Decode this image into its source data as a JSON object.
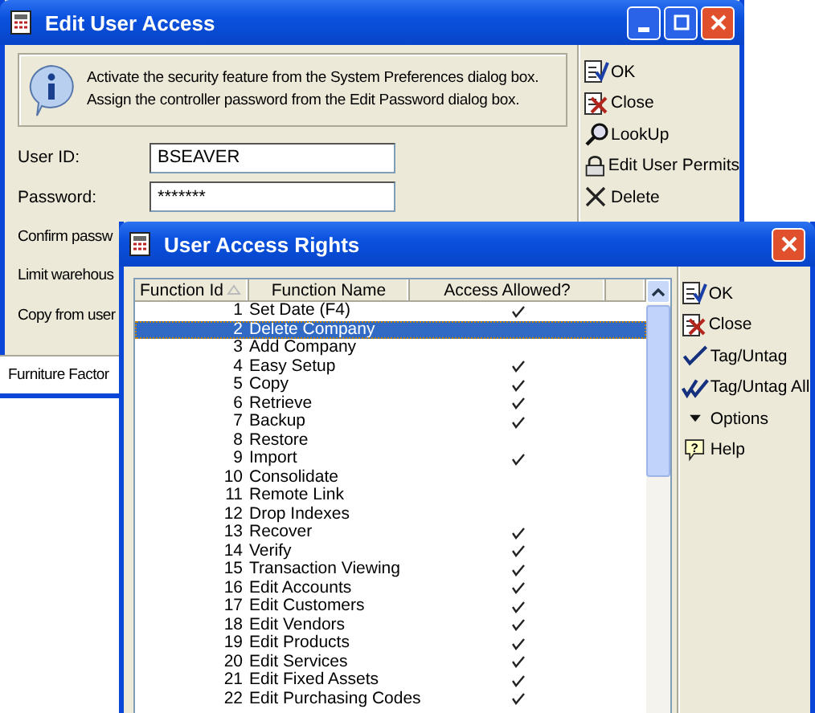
{
  "back_window": {
    "title": "Edit User Access",
    "info": [
      "Activate the security feature from the System Preferences dialog box.",
      "Assign the controller password from the Edit Password dialog box."
    ],
    "fields": [
      {
        "label": "User ID:",
        "value": "BSEAVER",
        "kind": "text"
      },
      {
        "label": "Password:",
        "value": "*******",
        "kind": "text"
      },
      {
        "label": "Confirm passw",
        "kind": "hidden"
      },
      {
        "label": "Limit warehous",
        "kind": "hidden"
      },
      {
        "label": "Copy from user",
        "kind": "hidden"
      }
    ],
    "buttons": [
      {
        "label": "OK"
      },
      {
        "label": "Close"
      },
      {
        "label": "LookUp"
      },
      {
        "label": "Edit User Permits"
      },
      {
        "label": "Delete"
      }
    ],
    "status_bar": "Furniture Factor"
  },
  "front_window": {
    "title": "User Access Rights",
    "table": {
      "columns": [
        "Function Id",
        "Function Name",
        "Access Allowed?"
      ],
      "rows": [
        {
          "id": "1",
          "name": "Set Date (F4)",
          "allowed": true,
          "selected": false
        },
        {
          "id": "2",
          "name": "Delete Company",
          "allowed": false,
          "selected": true
        },
        {
          "id": "3",
          "name": "Add Company",
          "allowed": false,
          "selected": false
        },
        {
          "id": "4",
          "name": "Easy Setup",
          "allowed": true,
          "selected": false
        },
        {
          "id": "5",
          "name": "Copy",
          "allowed": true,
          "selected": false
        },
        {
          "id": "6",
          "name": "Retrieve",
          "allowed": true,
          "selected": false
        },
        {
          "id": "7",
          "name": "Backup",
          "allowed": true,
          "selected": false
        },
        {
          "id": "8",
          "name": "Restore",
          "allowed": false,
          "selected": false
        },
        {
          "id": "9",
          "name": "Import",
          "allowed": true,
          "selected": false
        },
        {
          "id": "10",
          "name": "Consolidate",
          "allowed": false,
          "selected": false
        },
        {
          "id": "11",
          "name": "Remote Link",
          "allowed": false,
          "selected": false
        },
        {
          "id": "12",
          "name": "Drop Indexes",
          "allowed": false,
          "selected": false
        },
        {
          "id": "13",
          "name": "Recover",
          "allowed": true,
          "selected": false
        },
        {
          "id": "14",
          "name": "Verify",
          "allowed": true,
          "selected": false
        },
        {
          "id": "15",
          "name": "Transaction Viewing",
          "allowed": true,
          "selected": false
        },
        {
          "id": "16",
          "name": "Edit Accounts",
          "allowed": true,
          "selected": false
        },
        {
          "id": "17",
          "name": "Edit Customers",
          "allowed": true,
          "selected": false
        },
        {
          "id": "18",
          "name": "Edit Vendors",
          "allowed": true,
          "selected": false
        },
        {
          "id": "19",
          "name": "Edit Products",
          "allowed": true,
          "selected": false
        },
        {
          "id": "20",
          "name": "Edit Services",
          "allowed": true,
          "selected": false
        },
        {
          "id": "21",
          "name": "Edit Fixed Assets",
          "allowed": true,
          "selected": false
        },
        {
          "id": "22",
          "name": "Edit Purchasing Codes",
          "allowed": true,
          "selected": false
        }
      ]
    },
    "buttons": [
      {
        "label": "OK"
      },
      {
        "label": "Close"
      },
      {
        "label": "Tag/Untag"
      },
      {
        "label": "Tag/Untag All"
      },
      {
        "label": "Options"
      },
      {
        "label": "Help",
        "glyph": "?"
      }
    ]
  }
}
